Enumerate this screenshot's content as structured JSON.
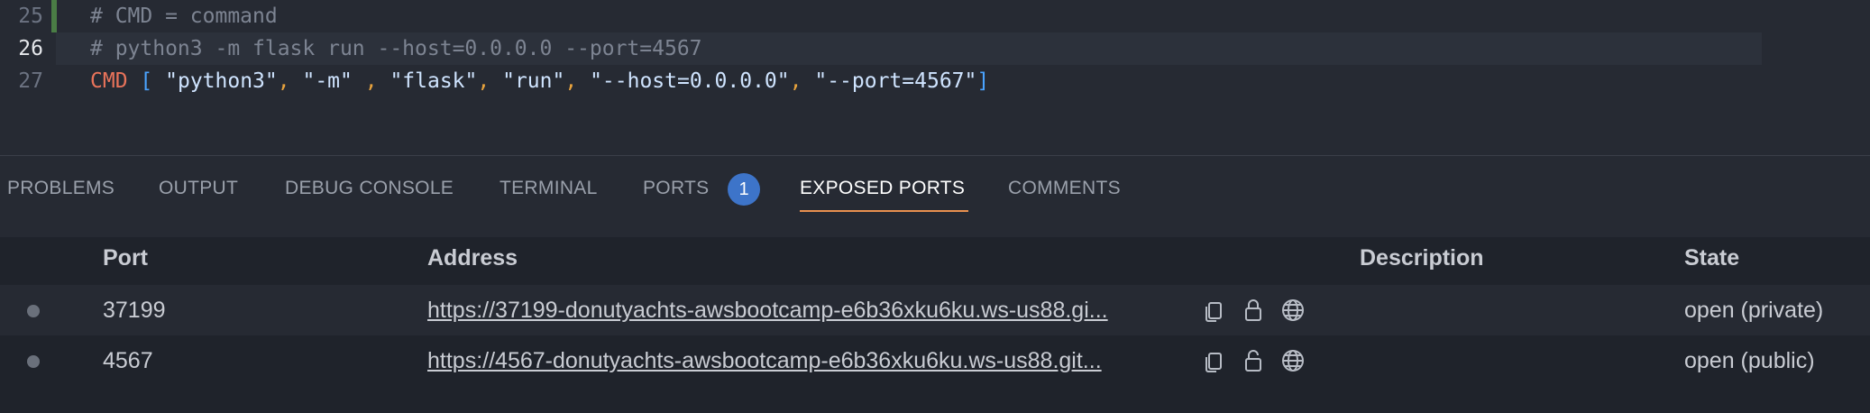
{
  "editor": {
    "lines": [
      {
        "number": "25",
        "text": "# CMD = command"
      },
      {
        "number": "26",
        "text": "# python3 -m flask run --host=0.0.0.0 --port=4567"
      },
      {
        "number": "27",
        "keyword": "CMD",
        "open": "[",
        "close": "]",
        "args": [
          "\"python3\"",
          "\"-m\"",
          "\"flask\"",
          "\"run\"",
          "\"--host=0.0.0.0\"",
          "\"--port=4567\""
        ]
      }
    ]
  },
  "panel": {
    "tabs": [
      {
        "label": "PROBLEMS"
      },
      {
        "label": "OUTPUT"
      },
      {
        "label": "DEBUG CONSOLE"
      },
      {
        "label": "TERMINAL"
      },
      {
        "label": "PORTS",
        "badge": "1"
      },
      {
        "label": "EXPOSED PORTS",
        "active": true
      },
      {
        "label": "COMMENTS"
      }
    ]
  },
  "ports": {
    "columns": [
      "Port",
      "Address",
      "Description",
      "State"
    ],
    "rows": [
      {
        "port": "37199",
        "address": "https://37199-donutyachts-awsbootcamp-e6b36xku6ku.ws-us88.gi...",
        "description": "",
        "state": "open (private)",
        "lock": "locked"
      },
      {
        "port": "4567",
        "address": "https://4567-donutyachts-awsbootcamp-e6b36xku6ku.ws-us88.git...",
        "description": "",
        "state": "open (public)",
        "lock": "unlocked"
      }
    ]
  },
  "colors": {
    "background": "#262a33",
    "active_tab_underline": "#e8904f",
    "badge": "#3d74c9",
    "keyword": "#e8735a",
    "bracket": "#4aa3ff",
    "comma": "#e8a33d"
  },
  "icons": [
    "copy-icon",
    "lock-icon",
    "unlock-icon",
    "globe-icon"
  ]
}
